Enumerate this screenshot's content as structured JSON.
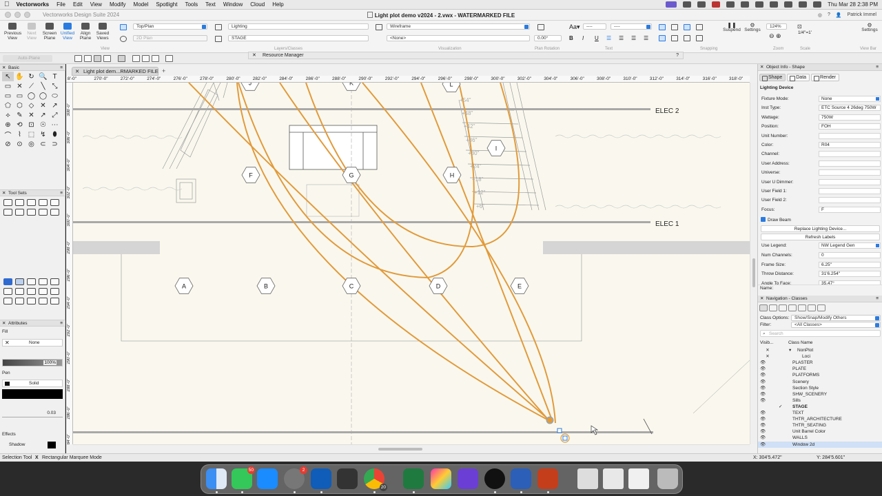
{
  "menubar": {
    "app_name": "Vectorworks",
    "items": [
      "File",
      "Edit",
      "View",
      "Modify",
      "Model",
      "Spotlight",
      "Tools",
      "Text",
      "Window",
      "Cloud",
      "Help"
    ],
    "datetime": "Thu Mar 28  2:38 PM"
  },
  "titlebar": {
    "suite": "Vectorworks Design Suite 2024",
    "document": "Light plot demo v2024 - 2.vwx - WATERMARKED FILE",
    "user": "Patrick Immel"
  },
  "toolbar": {
    "buttons": [
      "Previous View",
      "Next View",
      "Screen Plane",
      "Unified View",
      "Align Plane",
      "Saved Views"
    ],
    "view_label": "View",
    "view_select": "Top/Plan",
    "render_plane_select": "2D Plan",
    "class_select": "Lighting",
    "layer_select": "STAGE",
    "layers_classes_label": "Layers/Classes",
    "render_select": "Wireframe",
    "projection_select": "<None>",
    "visualization_label": "Visualization",
    "plan_rotation_value": "0.00°",
    "plan_rotation_label": "Plan Rotation",
    "text_label": "Text",
    "font_size_a": "----",
    "font_size_b": "----",
    "snapping_label": "Snapping",
    "suspend_label": "Suspend",
    "settings_label": "Settings",
    "zoom_value": "124%",
    "zoom_label": "Zoom",
    "scale_value": "1/4\"=1'",
    "scale_label": "Scale",
    "settings_right": "Settings",
    "view_bar_label": "View Bar",
    "auto_plane": "Auto-Plane"
  },
  "resource_manager": {
    "title": "Resource Manager",
    "help": "?"
  },
  "left": {
    "basic_title": "Basic",
    "basic_tools": [
      "↖",
      "✋",
      "↻",
      "🔍",
      "T",
      "▭",
      "✕",
      "⟋",
      "╲",
      "⤡",
      "▭",
      "▭",
      "◯",
      "◯",
      "⬭",
      "⬠",
      "⬡",
      "◇",
      "✕",
      "↗",
      "⟡",
      "✎",
      "✕",
      "↗",
      "⤢",
      "⊕",
      "⟲",
      "⊡",
      "☉",
      "⋯",
      "⌒",
      "⌇",
      "⬚",
      "↯",
      "⬮",
      "⊘",
      "⊙",
      "◎",
      "⊂",
      "⊃"
    ],
    "toolsets_title": "Tool Sets",
    "attributes_title": "Attributes",
    "fill_label": "Fill",
    "fill_value": "None",
    "opacity_value": "100%",
    "pen_label": "Pen",
    "pen_value": "Solid",
    "line_weight": "0.03",
    "effects_label": "Effects",
    "shadow_label": "Shadow"
  },
  "canvas": {
    "tab_title": "Light plot dem...RMARKED FILE",
    "ruler_top": [
      "8'-0\"",
      "270'-0\"",
      "272'-0\"",
      "274'-0\"",
      "276'-0\"",
      "278'-0\"",
      "280'-0\"",
      "282'-0\"",
      "284'-0\"",
      "286'-0\"",
      "288'-0\"",
      "290'-0\"",
      "292'-0\"",
      "294'-0\"",
      "296'-0\"",
      "298'-0\"",
      "300'-0\"",
      "302'-0\"",
      "304'-0\"",
      "306'-0\"",
      "308'-0\"",
      "310'-0\"",
      "312'-0\"",
      "314'-0\"",
      "316'-0\"",
      "318'-0\""
    ],
    "ruler_left": [
      "308'-0\"",
      "306'-0\"",
      "304'-0\"",
      "302'-0\"",
      "300'-0\"",
      "298'-0\"",
      "296'-0\"",
      "294'-0\"",
      "292'-0\"",
      "290'-0\"",
      "288'-0\"",
      "286'-0\"",
      "284'-0\""
    ],
    "elec2": "ELEC 2",
    "elec1": "ELEC 1",
    "grid_labels_top": [
      "J",
      "K",
      "L"
    ],
    "grid_labels_mid": [
      "F",
      "G",
      "H",
      "I"
    ],
    "grid_labels_bot": [
      "A",
      "B",
      "C",
      "D",
      "E"
    ],
    "seating_rows": [
      "+54\"",
      "+48\"",
      "+42\"",
      "+36\"",
      "+30\"",
      "+24\"",
      "+18\"",
      "+12\"",
      "+6\""
    ]
  },
  "object_info": {
    "title": "Object Info - Shape",
    "tabs": [
      "Shape",
      "Data",
      "Render"
    ],
    "object_type": "Lighting Device",
    "fields": [
      {
        "label": "Fixture Mode:",
        "value": "None"
      },
      {
        "label": "Inst Type:",
        "value": "ETC Source 4 26deg 750W"
      },
      {
        "label": "Wattage:",
        "value": "750W"
      },
      {
        "label": "Position:",
        "value": "FOH"
      },
      {
        "label": "Unit Number:",
        "value": ""
      },
      {
        "label": "Color:",
        "value": "R04"
      },
      {
        "label": "Channel:",
        "value": ""
      },
      {
        "label": "User Address:",
        "value": ""
      },
      {
        "label": "Universe:",
        "value": ""
      },
      {
        "label": "User U Dimmer:",
        "value": ""
      },
      {
        "label": "User Field 1:",
        "value": ""
      },
      {
        "label": "User Field 2:",
        "value": ""
      },
      {
        "label": "Focus:",
        "value": "F"
      }
    ],
    "draw_beam": "Draw Beam",
    "replace_btn": "Replace Lighting Device...",
    "refresh_btn": "Refresh Labels",
    "fields2": [
      {
        "label": "Use Legend:",
        "value": "NW Legend Gen"
      },
      {
        "label": "Num Channels:",
        "value": "0"
      },
      {
        "label": "Frame Size:",
        "value": "6.25\""
      },
      {
        "label": "Throw Distance:",
        "value": "31'6.254\""
      },
      {
        "label": "Angle To Face:",
        "value": "35.47°"
      }
    ],
    "name_label": "Name:"
  },
  "navigation": {
    "title": "Navigation - Classes",
    "class_options_label": "Class Options:",
    "class_options_value": "Show/Snap/Modify Others",
    "filter_label": "Filter:",
    "filter_value": "<All Classes>",
    "search_placeholder": "Search",
    "col_visibility": "Visib...",
    "col_class": "Class Name",
    "rows": [
      {
        "vis": "✕",
        "name": "NonPlot",
        "check": false,
        "indent": 1,
        "expanded": true
      },
      {
        "vis": "✕",
        "name": "Loci",
        "check": false,
        "indent": 2
      },
      {
        "vis": "👁",
        "name": "PLASTER",
        "check": false,
        "indent": 0
      },
      {
        "vis": "👁",
        "name": "PLATE",
        "check": false,
        "indent": 0
      },
      {
        "vis": "👁",
        "name": "PLATFORMS",
        "check": false,
        "indent": 0
      },
      {
        "vis": "👁",
        "name": "Scenery",
        "check": false,
        "indent": 0
      },
      {
        "vis": "👁",
        "name": "Section Style",
        "check": false,
        "indent": 0
      },
      {
        "vis": "👁",
        "name": "SHW_SCENERY",
        "check": false,
        "indent": 0
      },
      {
        "vis": "👁",
        "name": "Sills",
        "check": false,
        "indent": 0
      },
      {
        "vis": "",
        "name": "STAGE",
        "check": true,
        "indent": 0
      },
      {
        "vis": "👁",
        "name": "TEXT",
        "check": false,
        "indent": 0
      },
      {
        "vis": "👁",
        "name": "THTR_ARCHITECTURE",
        "check": false,
        "indent": 0
      },
      {
        "vis": "👁",
        "name": "THTR_SEATING",
        "check": false,
        "indent": 0
      },
      {
        "vis": "👁",
        "name": "Unit Barrel Color",
        "check": false,
        "indent": 0
      },
      {
        "vis": "👁",
        "name": "WALLS",
        "check": false,
        "indent": 0
      },
      {
        "vis": "👁",
        "name": "Window 2d",
        "check": false,
        "indent": 0,
        "highlight": true
      }
    ]
  },
  "status": {
    "tool": "Selection Tool",
    "mode_x": "X",
    "mode": "Rectangular Marquee Mode",
    "x_coord": "X: 304'5.472\"",
    "y_coord": "Y: 284'5.601\""
  },
  "dock": {
    "badges": {
      "messages": "50",
      "settings": "2",
      "chrome": "20"
    }
  },
  "colors": {
    "beam": "#e29a3a",
    "canvas_bg": "#faf8ee",
    "accent": "#2a7be0",
    "highlight_row": "#cfe0f7"
  }
}
